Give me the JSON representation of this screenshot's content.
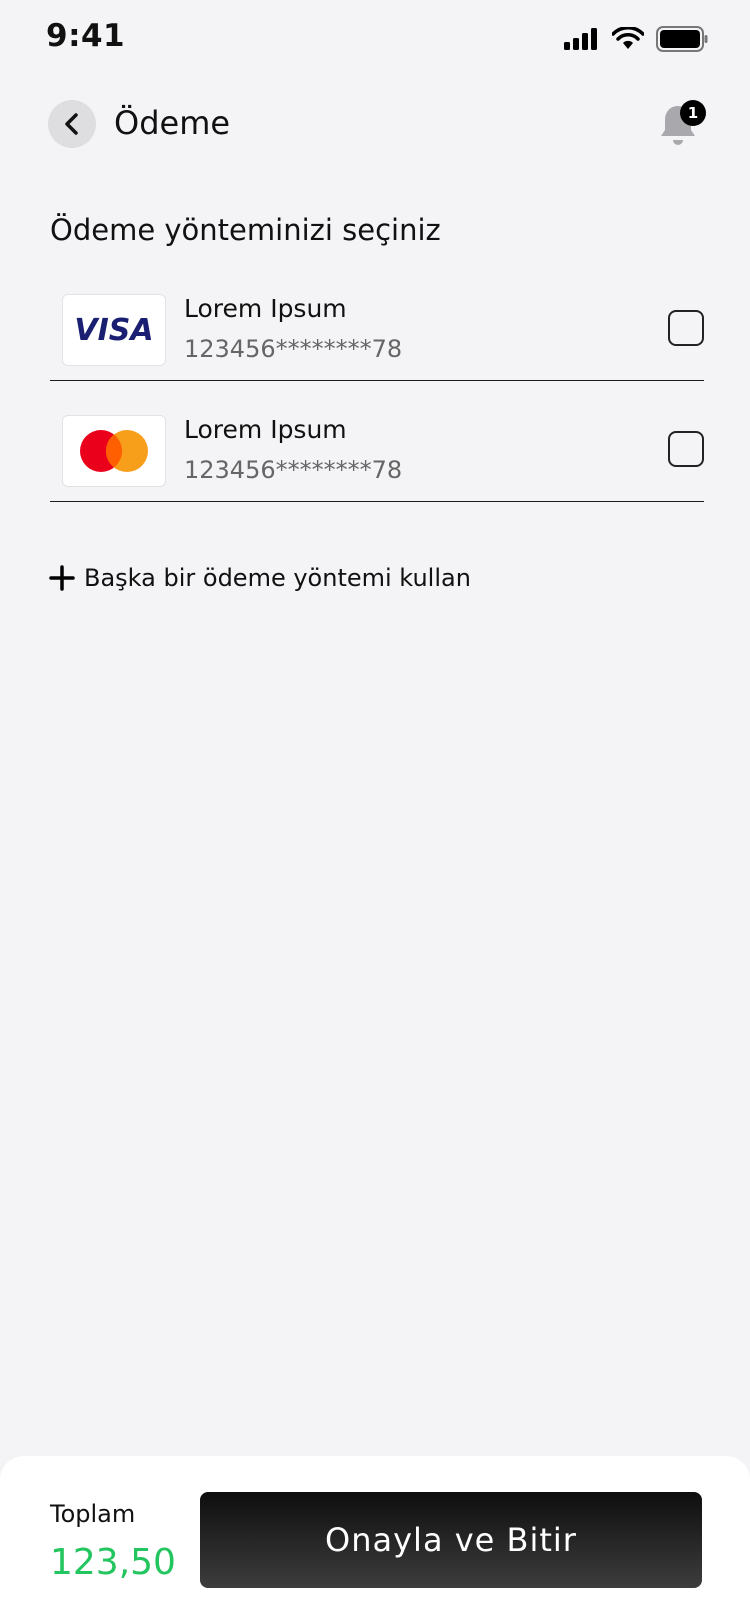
{
  "status_bar": {
    "time": "9:41"
  },
  "header": {
    "title": "Ödeme",
    "notification_count": "1"
  },
  "section_title": "Ödeme yönteminizi seçiniz",
  "payment_methods": [
    {
      "brand": "visa",
      "logo_text": "VISA",
      "name": "Lorem Ipsum",
      "number": "123456********78",
      "checked": false
    },
    {
      "brand": "mastercard",
      "name": "Lorem Ipsum",
      "number": "123456********78",
      "checked": false
    }
  ],
  "add_method_label": "Başka bir ödeme yöntemi kullan",
  "footer": {
    "total_label": "Toplam",
    "total_value": "123,50",
    "confirm_label": "Onayla ve Bitir"
  },
  "colors": {
    "accent": "#22c55e",
    "background": "#f4f4f6",
    "visa_blue": "#1a1f71",
    "mc_red": "#eb001b",
    "mc_orange": "#f79e1b"
  }
}
